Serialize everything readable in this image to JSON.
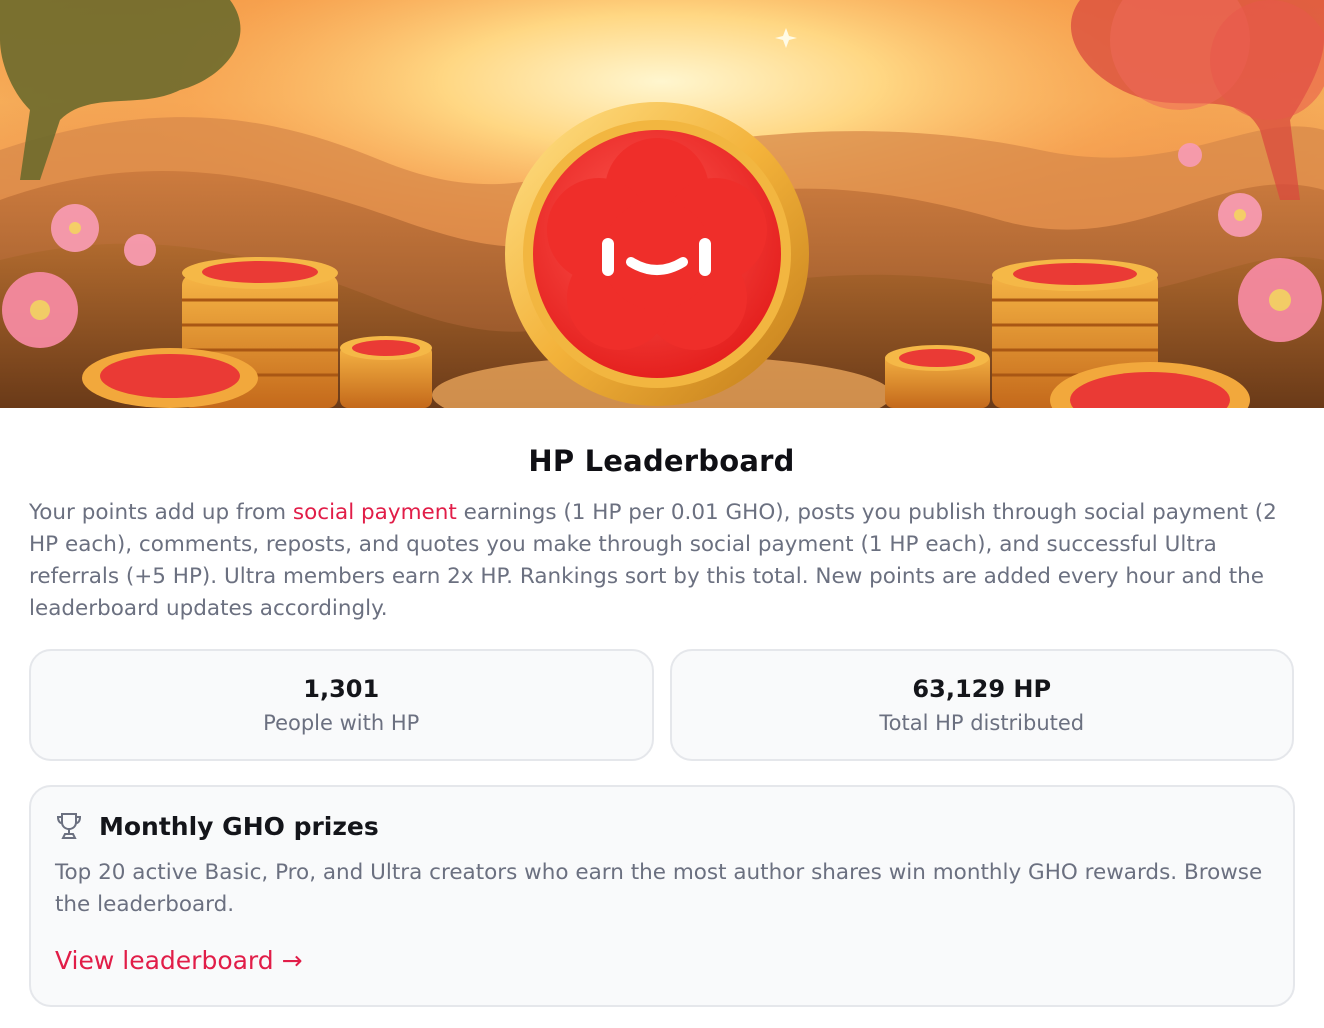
{
  "hero": {
    "image_name": "sunset-coins-banner"
  },
  "page": {
    "title": "HP Leaderboard",
    "description_before_link": "Your points add up from ",
    "description_link": "social payment",
    "description_after_link": " earnings (1 HP per 0.01 GHO), posts you publish through social payment (2 HP each), comments, reposts, and quotes you make through social payment (1 HP each), and successful Ultra referrals (+5 HP). Ultra members earn 2x HP. Rankings sort by this total. New points are added every hour and the leaderboard updates accordingly."
  },
  "stats": [
    {
      "value": "1,301",
      "label": "People with HP"
    },
    {
      "value": "63,129 HP",
      "label": "Total HP distributed"
    }
  ],
  "prizes": {
    "icon": "trophy-icon",
    "title": "Monthly GHO prizes",
    "description": "Top 20 active Basic, Pro, and Ultra creators who earn the most author shares win monthly GHO rewards. Browse the leaderboard.",
    "link_label": "View leaderboard →"
  },
  "colors": {
    "accent": "#e11d48",
    "muted_text": "#6b7080",
    "card_border": "#e5e7eb"
  }
}
